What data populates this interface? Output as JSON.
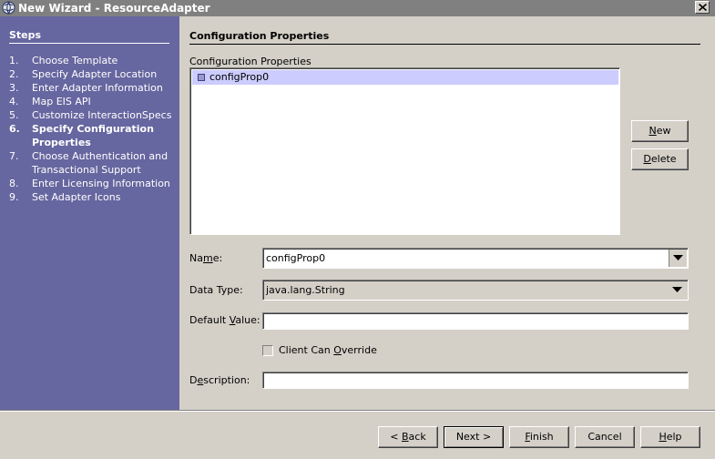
{
  "window": {
    "title": "New Wizard - ResourceAdapter",
    "icon": "app-globe-icon",
    "close_icon": "close-icon"
  },
  "steps": {
    "title": "Steps",
    "items": [
      {
        "num": "1.",
        "label": "Choose Template"
      },
      {
        "num": "2.",
        "label": "Specify Adapter Location"
      },
      {
        "num": "3.",
        "label": "Enter Adapter Information"
      },
      {
        "num": "4.",
        "label": "Map EIS API"
      },
      {
        "num": "5.",
        "label": "Customize InteractionSpecs"
      },
      {
        "num": "6.",
        "label": "Specify Configuration Properties",
        "current": true
      },
      {
        "num": "7.",
        "label": "Choose Authentication and Transactional Support"
      },
      {
        "num": "8.",
        "label": "Enter Licensing Information"
      },
      {
        "num": "9.",
        "label": "Set Adapter Icons"
      }
    ]
  },
  "main": {
    "header": "Configuration Properties",
    "list_caption": "Configuration Properties",
    "list_items": [
      {
        "label": "configProp0",
        "selected": true
      }
    ],
    "new_button": {
      "pre": "",
      "mnemonic": "N",
      "post": "ew"
    },
    "delete_button": {
      "pre": "",
      "mnemonic": "D",
      "post": "elete"
    },
    "name": {
      "label_pre": "Na",
      "label_mnemonic": "m",
      "label_post": "e:",
      "value": "configProp0"
    },
    "data_type": {
      "label": "Data Type:",
      "value": "java.lang.String"
    },
    "default_value": {
      "label_pre": "Default ",
      "label_mnemonic": "V",
      "label_post": "alue:",
      "value": ""
    },
    "client_override": {
      "label_pre": "Client Can ",
      "label_mnemonic": "O",
      "label_post": "verride",
      "checked": false
    },
    "description": {
      "label_pre": "D",
      "label_mnemonic": "e",
      "label_post": "scription:",
      "value": ""
    }
  },
  "footer": {
    "back": {
      "pre": "< ",
      "mnemonic": "B",
      "post": "ack"
    },
    "next": {
      "pre": "Next >",
      "mnemonic": "",
      "post": ""
    },
    "finish": {
      "pre": "",
      "mnemonic": "F",
      "post": "inish"
    },
    "cancel": {
      "pre": "Cancel",
      "mnemonic": "",
      "post": ""
    },
    "help": {
      "pre": "",
      "mnemonic": "H",
      "post": "elp"
    }
  },
  "colors": {
    "steps_panel_bg": "#6666a0",
    "window_bg": "#d4d0c8",
    "selection_bg": "#ccccff",
    "titlebar_bg": "#808080"
  }
}
